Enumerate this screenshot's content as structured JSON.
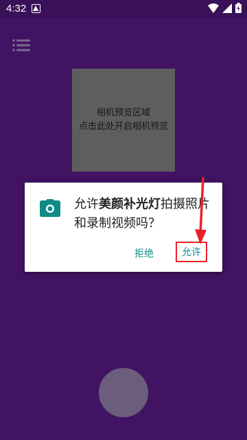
{
  "status_bar": {
    "time": "4:32"
  },
  "camera_preview": {
    "line1": "相机预览区域",
    "line2": "点击此处开启相机预览"
  },
  "dialog": {
    "message_prefix": "允许",
    "app_name": "美颜补光灯",
    "message_suffix": "拍摄照片和录制视频吗？",
    "deny_label": "拒绝",
    "allow_label": "允许"
  },
  "colors": {
    "background": "#4a1670",
    "dialog_button": "#0e8c86",
    "annotation": "#e8202a"
  }
}
